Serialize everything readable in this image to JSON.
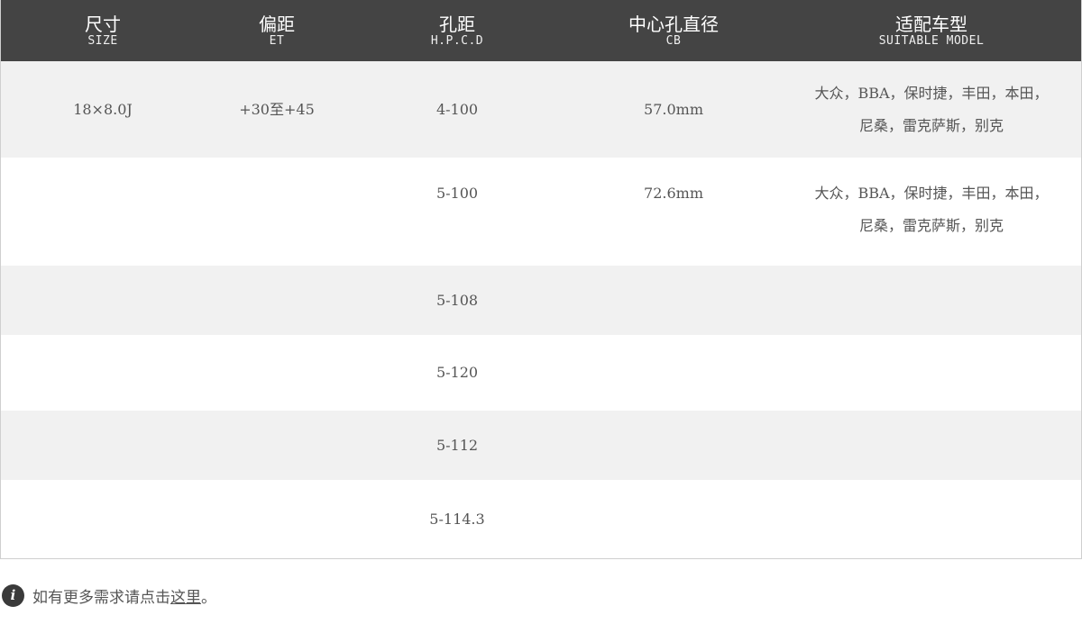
{
  "header": {
    "columns": [
      {
        "zh": "尺寸",
        "en": "SIZE"
      },
      {
        "zh": "偏距",
        "en": "ET"
      },
      {
        "zh": "孔距",
        "en": "H.P.C.D"
      },
      {
        "zh": "中心孔直径",
        "en": "CB"
      },
      {
        "zh": "适配车型",
        "en": "SUITABLE MODEL"
      }
    ]
  },
  "rows": [
    {
      "size": "18×8.0J",
      "et": "+30至+45",
      "pcd": "4-100",
      "cb": "57.0mm",
      "model": "大众，BBA，保时捷，丰田，本田，\n尼桑，雷克萨斯，别克"
    },
    {
      "size": "",
      "et": "",
      "pcd": "5-100",
      "cb": "72.6mm",
      "model": "大众，BBA，保时捷，丰田，本田，\n尼桑，雷克萨斯，别克"
    },
    {
      "size": "",
      "et": "",
      "pcd": "5-108",
      "cb": "",
      "model": ""
    },
    {
      "size": "",
      "et": "",
      "pcd": "5-120",
      "cb": "",
      "model": ""
    },
    {
      "size": "",
      "et": "",
      "pcd": "5-112",
      "cb": "",
      "model": ""
    },
    {
      "size": "",
      "et": "",
      "pcd": "5-114.3",
      "cb": "",
      "model": ""
    }
  ],
  "note": {
    "icon": "info-icon",
    "text": "如有更多需求请点击",
    "link": "这里",
    "suffix": "。"
  },
  "colors": {
    "header_bg": "#444444",
    "row_grey": "#f1f1f1",
    "text": "#555555"
  }
}
